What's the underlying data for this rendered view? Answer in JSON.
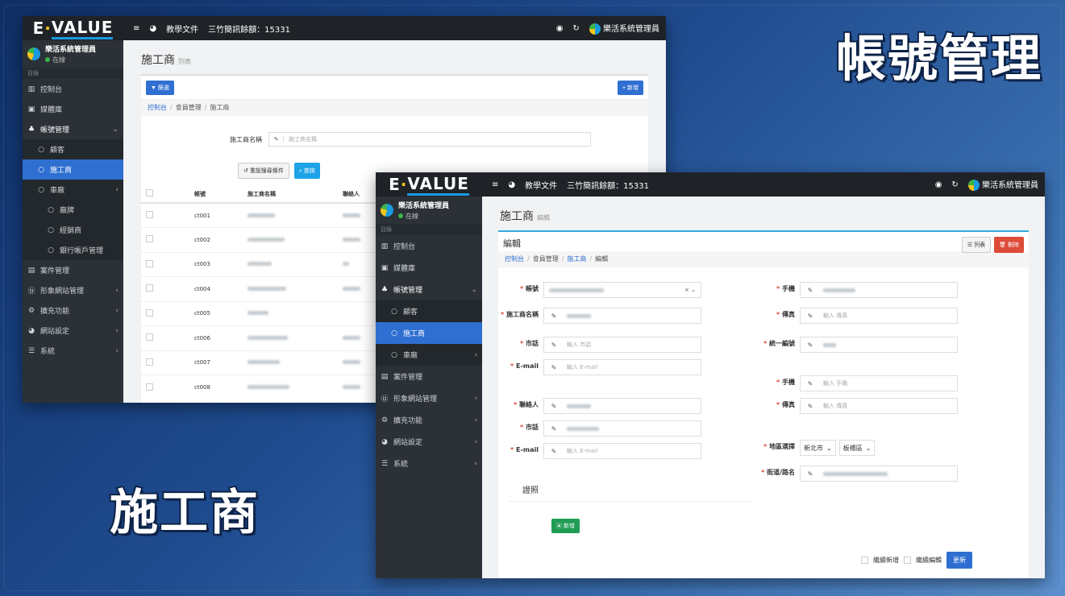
{
  "overlay": {
    "title_account": "帳號管理",
    "title_contractor": "施工商"
  },
  "app": {
    "logo_a": "E",
    "logo_b": "·",
    "logo_c": "VALUE",
    "menu_icon": "hamburger-icon",
    "nav_docs": "教學文件",
    "nav_remote": "三竹簡訊餘額：15331",
    "user_name": "樂活系統管理員",
    "status": "在線",
    "section": "目錄"
  },
  "sidebar": {
    "dashboard": "控制台",
    "media": "媒體庫",
    "account_mgmt": "帳號管理",
    "customers": "顧客",
    "contractor": "施工商",
    "vehicles": "車廠",
    "brand": "廠牌",
    "dealer": "經銷商",
    "bank_account": "銀行帳戶管理",
    "case_mgmt": "案件管理",
    "image_site": "形象網站管理",
    "extensions": "擴充功能",
    "site_settings": "網站設定",
    "system": "系統"
  },
  "list_page": {
    "title": "施工商",
    "subtitle": "列表",
    "filter_btn": "篩選",
    "add_btn": "新增",
    "crumbs": [
      "控制台",
      "會員管理",
      "施工商"
    ],
    "search_label": "施工商名稱",
    "search_placeholder": "施工商名稱",
    "reset_btn": "重設搜尋條件",
    "query_btn": "查詢",
    "columns": [
      "帳號",
      "施工商名稱",
      "聯絡人"
    ],
    "rows": [
      "ct001",
      "ct002",
      "ct003",
      "ct004",
      "ct005",
      "ct006",
      "ct007",
      "ct008"
    ]
  },
  "edit_page": {
    "title": "施工商",
    "subtitle": "編輯",
    "panel_title": "編輯",
    "list_btn": "列表",
    "delete_btn": "刪除",
    "crumbs": [
      "控制台",
      "會員管理",
      "施工商",
      "編輯"
    ],
    "labels": {
      "account": "帳號",
      "name": "施工商名稱",
      "phone": "市話",
      "email": "E-mail",
      "contact": "聯絡人",
      "tel": "市話",
      "email2": "E-mail",
      "mobile": "手機",
      "fax": "傳真",
      "tax_id": "統一編號",
      "mobile2": "手機",
      "fax2": "傳真",
      "region": "地區選擇",
      "street": "街道/路名"
    },
    "placeholders": {
      "phone": "輸入 市話",
      "email": "輸入 E-mail",
      "email2": "輸入 E-mail",
      "fax": "輸入 傳真",
      "mobile2": "輸入 手機",
      "fax2": "輸入 傳真"
    },
    "city": "新北市",
    "district": "板橋區",
    "section_license": "證照",
    "add_btn": "新增",
    "keep_add": "繼續新增",
    "keep_edit": "繼續編輯",
    "update_btn": "更新"
  }
}
